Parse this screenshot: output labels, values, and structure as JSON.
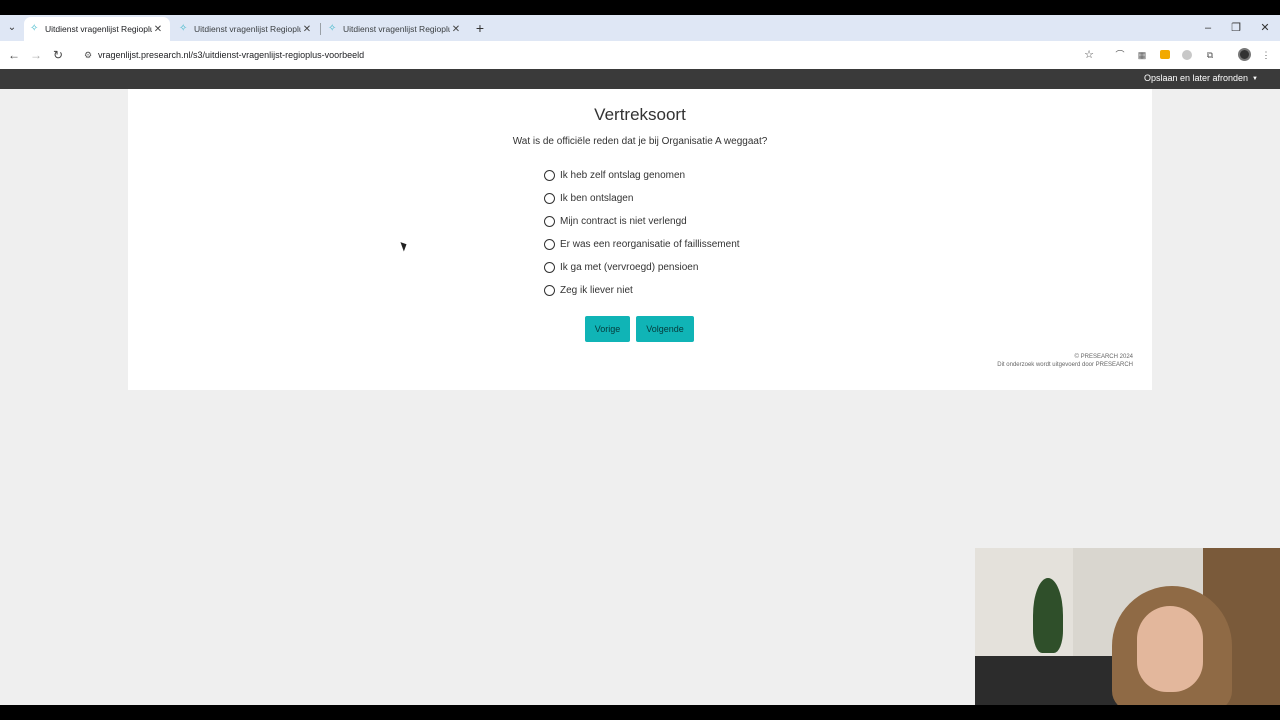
{
  "browser": {
    "tabs": [
      {
        "title": "Uitdienst vragenlijst Regioplus",
        "active": true
      },
      {
        "title": "Uitdienst vragenlijst Regioplus",
        "active": false
      },
      {
        "title": "Uitdienst vragenlijst Regioplus",
        "active": false
      }
    ],
    "url": "vragenlijst.presearch.nl/s3/uitdienst-vragenlijst-regioplus-voorbeeld"
  },
  "survey": {
    "save_later_label": "Opslaan en later afronden",
    "title": "Vertreksoort",
    "question": "Wat is de officiële reden dat je bij Organisatie A weggaat?",
    "options": [
      "Ik heb zelf ontslag genomen",
      "Ik ben ontslagen",
      "Mijn contract is niet verlengd",
      "Er was een reorganisatie of faillissement",
      "Ik ga met (vervroegd) pensioen",
      "Zeg ik liever niet"
    ],
    "prev_label": "Vorige",
    "next_label": "Volgende",
    "footer_copyright": "© PRESEARCH 2024",
    "footer_note": "Dit onderzoek wordt uitgevoerd door PRESEARCH"
  },
  "colors": {
    "button": "#10b4b6",
    "topbar": "#3a3a3a",
    "page_bg": "#efefef",
    "tabstrip": "#dfe7f5"
  }
}
